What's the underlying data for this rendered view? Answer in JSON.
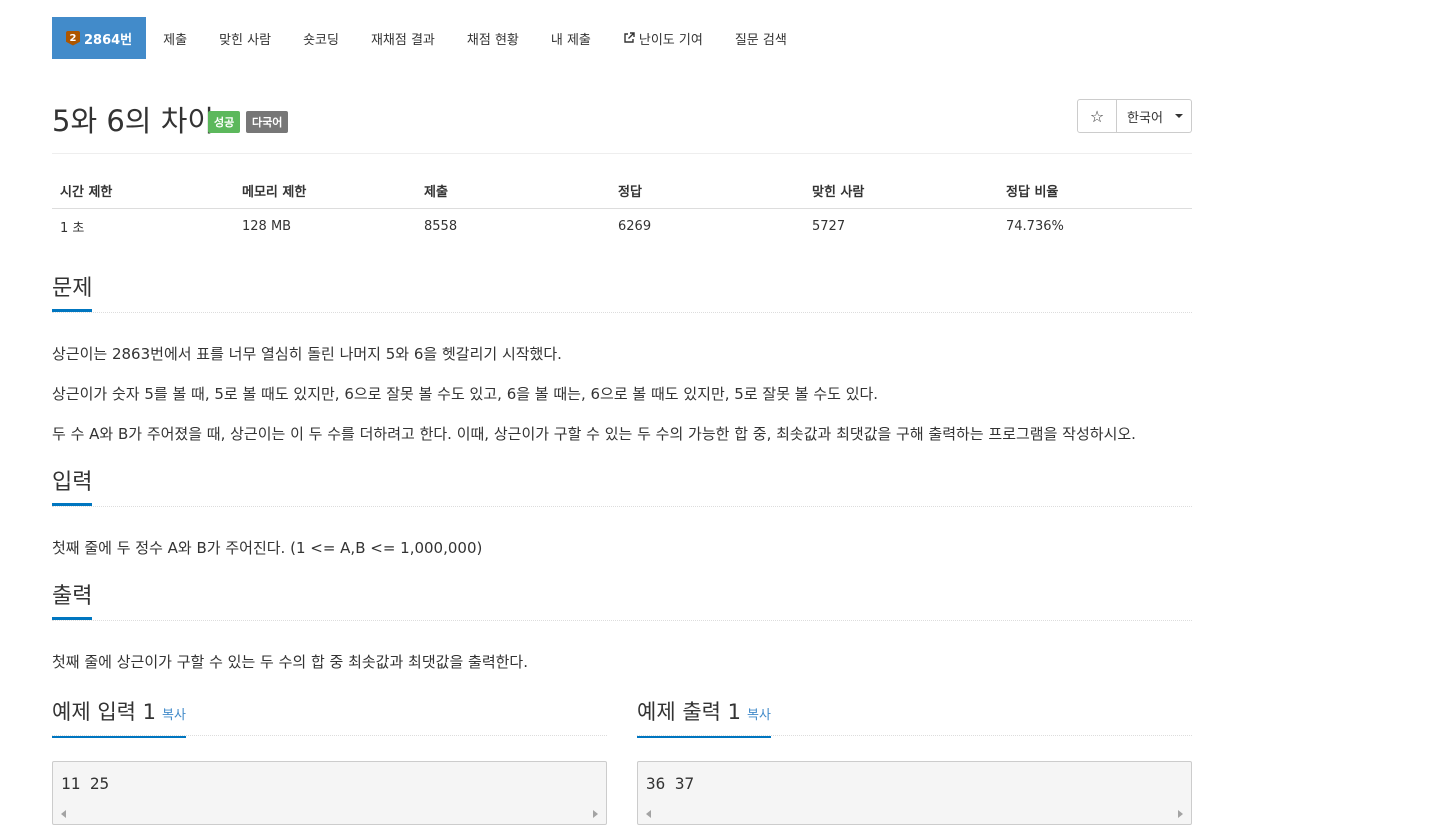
{
  "tabs": [
    {
      "label": "2864번",
      "icon": "tier-badge-icon",
      "badge": "2",
      "active": true
    },
    {
      "label": "제출"
    },
    {
      "label": "맞힌 사람"
    },
    {
      "label": "숏코딩"
    },
    {
      "label": "재채점 결과"
    },
    {
      "label": "채점 현황"
    },
    {
      "label": "내 제출"
    },
    {
      "label": "난이도 기여",
      "icon": "external-link-icon"
    },
    {
      "label": "질문 검색"
    }
  ],
  "problem": {
    "title": "5와 6의 차이",
    "labels": {
      "success": "성공",
      "multilang": "다국어"
    },
    "star_icon": "☆",
    "language": "한국어"
  },
  "info": {
    "headers": [
      "시간 제한",
      "메모리 제한",
      "제출",
      "정답",
      "맞힌 사람",
      "정답 비율"
    ],
    "values": [
      "1 초",
      "128 MB",
      "8558",
      "6269",
      "5727",
      "74.736%"
    ]
  },
  "sections": {
    "description": {
      "title": "문제",
      "paragraphs": [
        "상근이는 2863번에서 표를 너무 열심히 돌린 나머지 5와 6을 헷갈리기 시작했다.",
        "상근이가 숫자 5를 볼 때, 5로 볼 때도 있지만, 6으로 잘못 볼 수도 있고, 6을 볼 때는, 6으로 볼 때도 있지만, 5로 잘못 볼 수도 있다.",
        "두 수 A와 B가 주어졌을 때, 상근이는 이 두 수를 더하려고 한다. 이때, 상근이가 구할 수 있는 두 수의 가능한 합 중, 최솟값과 최댓값을 구해 출력하는 프로그램을 작성하시오."
      ]
    },
    "input": {
      "title": "입력",
      "text": "첫째 줄에 두 정수 A와 B가 주어진다. (1 <= A,B <= 1,000,000)"
    },
    "output": {
      "title": "출력",
      "text": "첫째 줄에 상근이가 구할 수 있는 두 수의 합 중 최솟값과 최댓값을 출력한다."
    }
  },
  "samples": {
    "input": {
      "title": "예제 입력 1",
      "copy": "복사",
      "content": "11 25"
    },
    "output": {
      "title": "예제 출력 1",
      "copy": "복사",
      "content": "36 37"
    }
  },
  "colors": {
    "primary": "#428bca",
    "success": "#5cb85c",
    "label_gray": "#777777",
    "underline": "#0076c0"
  }
}
